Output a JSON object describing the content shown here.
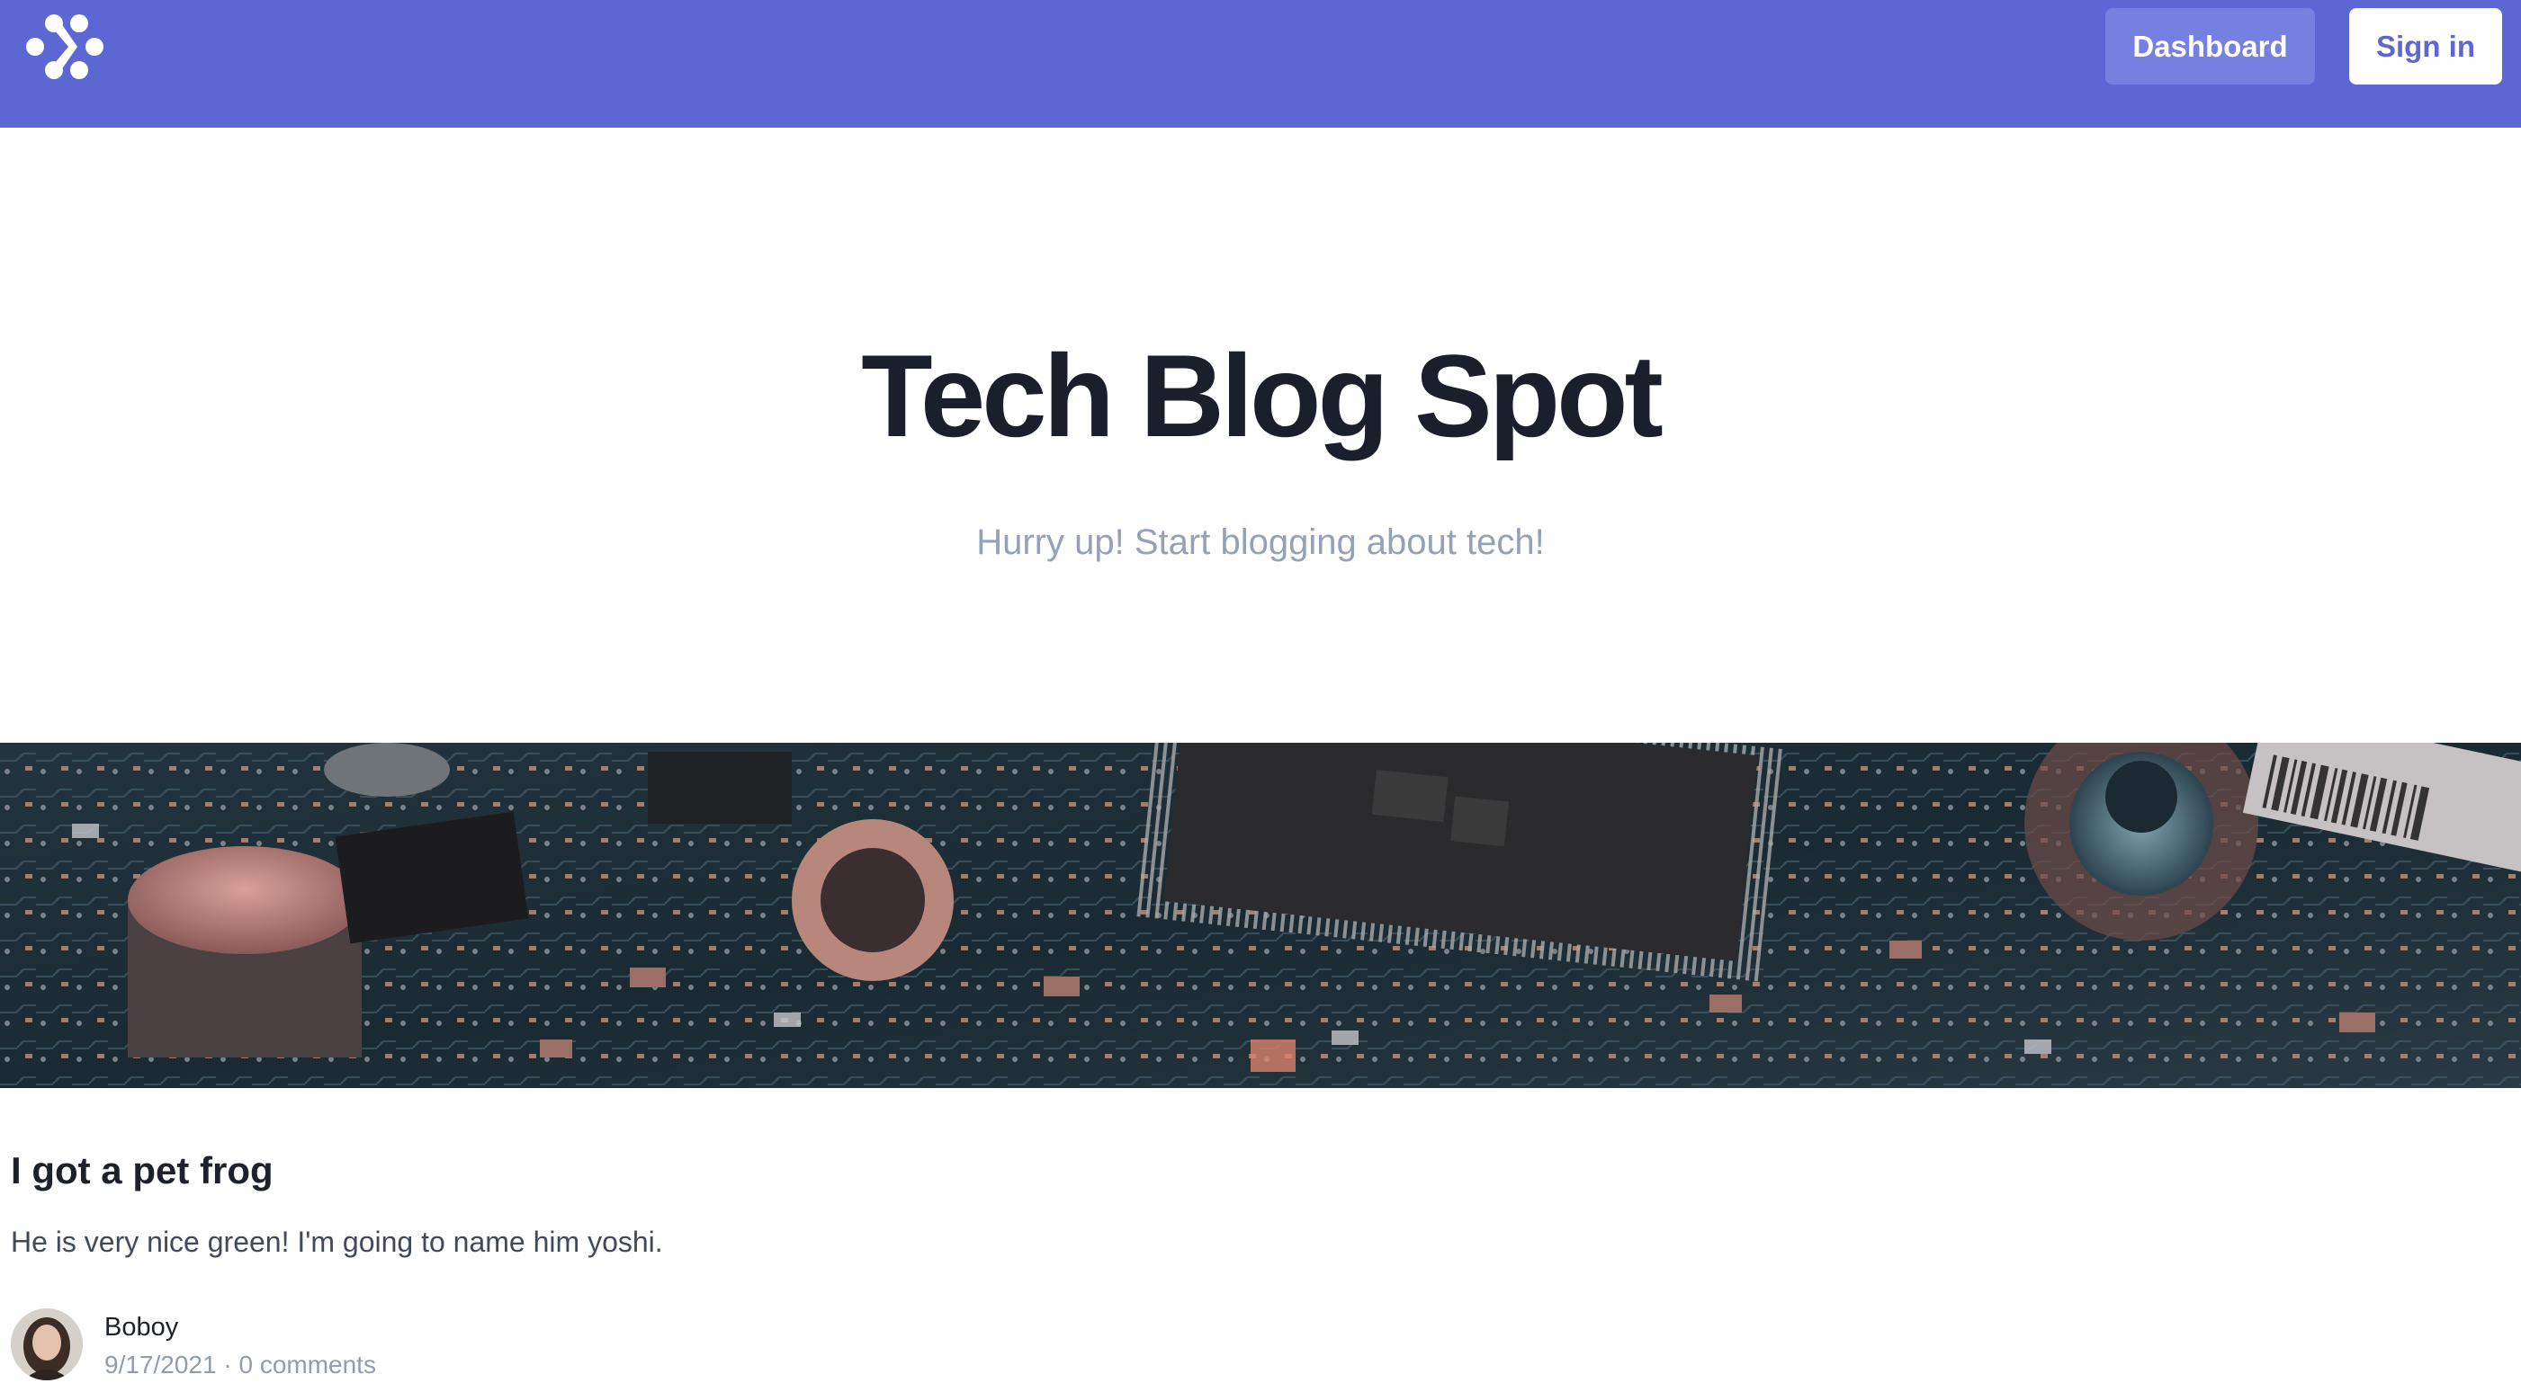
{
  "header": {
    "logo_icon": "flower-dots-logo-icon",
    "dashboard_label": "Dashboard",
    "signin_label": "Sign in",
    "bar_color": "#5d67d3"
  },
  "hero": {
    "title": "Tech Blog Spot",
    "subtitle": "Hurry up! Start blogging about tech!"
  },
  "banner": {
    "image_subject": "circuit-board-photo"
  },
  "post": {
    "title": "I got a pet frog",
    "excerpt": "He is very nice green! I'm going to name him yoshi.",
    "author": "Boboy",
    "date": "9/17/2021",
    "separator": "·",
    "comments": "0 comments",
    "avatar_icon": "author-avatar"
  }
}
